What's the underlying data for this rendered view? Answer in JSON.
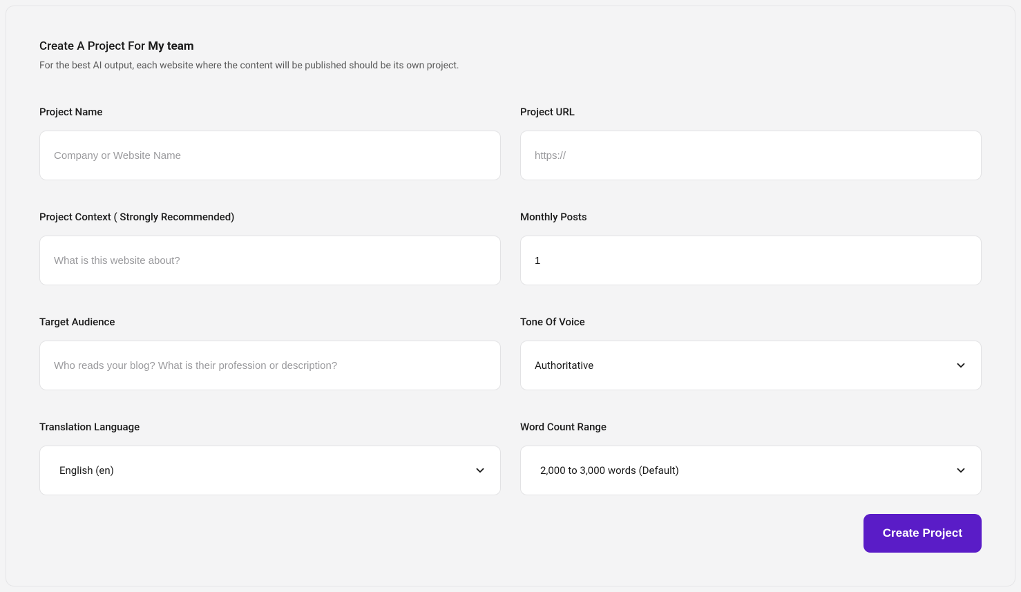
{
  "header": {
    "title_prefix": "Create A Project For ",
    "title_bold": "My team",
    "subtitle": "For the best AI output, each website where the content will be published should be its own project."
  },
  "fields": {
    "project_name": {
      "label": "Project Name",
      "placeholder": "Company or Website Name",
      "value": ""
    },
    "project_url": {
      "label": "Project URL",
      "placeholder": "https://",
      "value": ""
    },
    "project_context": {
      "label": "Project Context ( Strongly Recommended)",
      "placeholder": "What is this website about?",
      "value": ""
    },
    "monthly_posts": {
      "label": "Monthly Posts",
      "value": "1"
    },
    "target_audience": {
      "label": "Target Audience",
      "placeholder": "Who reads your blog? What is their profession or description?",
      "value": ""
    },
    "tone_of_voice": {
      "label": "Tone Of Voice",
      "selected": "Authoritative"
    },
    "translation_language": {
      "label": "Translation Language",
      "selected": "English (en)"
    },
    "word_count_range": {
      "label": "Word Count Range",
      "selected": "2,000 to 3,000 words (Default)"
    }
  },
  "actions": {
    "create_label": "Create Project"
  }
}
